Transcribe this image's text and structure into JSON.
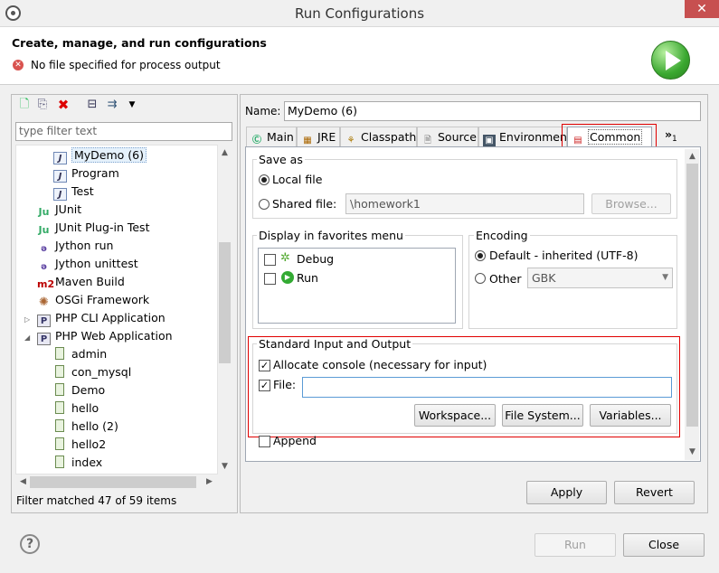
{
  "window": {
    "title": "Run Configurations",
    "close_glyph": "✕"
  },
  "header": {
    "title": "Create, manage, and run configurations",
    "message": "No file specified for process output"
  },
  "left": {
    "filter_placeholder": "type filter text",
    "items": [
      {
        "label": "MyDemo (6)",
        "icon": "java-app-icon"
      },
      {
        "label": "Program",
        "icon": "java-app-icon"
      },
      {
        "label": "Test",
        "icon": "java-app-icon"
      },
      {
        "label": "JUnit",
        "icon": "junit-icon"
      },
      {
        "label": "JUnit Plug-in Test",
        "icon": "junit-plugin-icon"
      },
      {
        "label": "Jython run",
        "icon": "jython-icon"
      },
      {
        "label": "Jython unittest",
        "icon": "jython-unittest-icon"
      },
      {
        "label": "Maven Build",
        "icon": "maven-icon"
      },
      {
        "label": "OSGi Framework",
        "icon": "osgi-icon"
      },
      {
        "label": "PHP CLI Application",
        "icon": "php-icon"
      },
      {
        "label": "PHP Web Application",
        "icon": "php-icon"
      },
      {
        "label": "admin",
        "icon": "php-file-icon"
      },
      {
        "label": "con_mysql",
        "icon": "php-file-icon"
      },
      {
        "label": "Demo",
        "icon": "php-file-icon"
      },
      {
        "label": "hello",
        "icon": "php-file-icon"
      },
      {
        "label": "hello (2)",
        "icon": "php-file-icon"
      },
      {
        "label": "hello2",
        "icon": "php-file-icon"
      },
      {
        "label": "index",
        "icon": "php-file-icon"
      }
    ],
    "status": "Filter matched 47 of 59 items"
  },
  "config": {
    "name_label": "Name:",
    "name_value": "MyDemo (6)",
    "tabs": [
      "Main",
      "JRE",
      "Classpath",
      "Source",
      "Environment",
      "Common"
    ],
    "tabs_overflow": "»",
    "tabs_overflow_count": "1",
    "save_as": {
      "title": "Save as",
      "local": "Local file",
      "shared": "Shared file:",
      "shared_path": "\\homework1",
      "browse": "Browse..."
    },
    "favorites": {
      "title": "Display in favorites menu",
      "debug": "Debug",
      "run": "Run"
    },
    "encoding": {
      "title": "Encoding",
      "default": "Default - inherited (UTF-8)",
      "other": "Other",
      "other_value": "GBK"
    },
    "stdio": {
      "title": "Standard Input and Output",
      "allocate": "Allocate console (necessary for input)",
      "file": "File:",
      "workspace": "Workspace...",
      "filesystem": "File System...",
      "variables": "Variables...",
      "append": "Append"
    },
    "apply": "Apply",
    "revert": "Revert"
  },
  "footer": {
    "help": "?",
    "run": "Run",
    "close": "Close"
  }
}
